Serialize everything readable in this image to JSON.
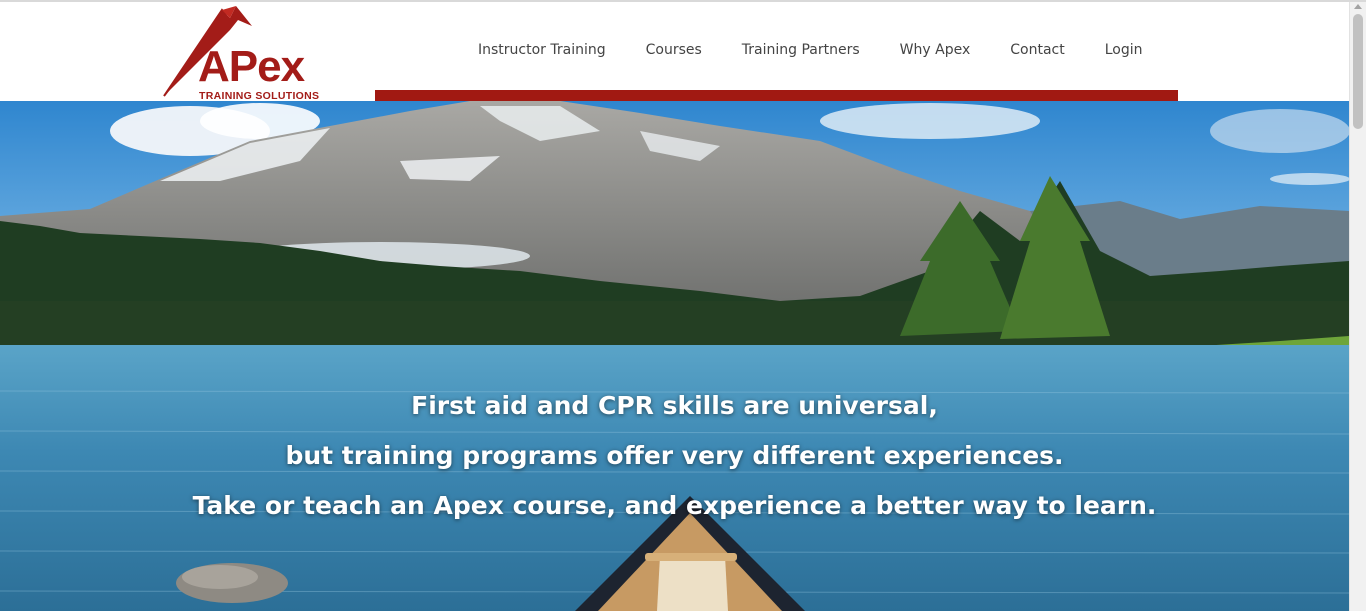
{
  "brand": {
    "name": "APex",
    "tagline": "TRAINING SOLUTIONS",
    "color": "#a31c18"
  },
  "nav": {
    "items": [
      {
        "label": "Instructor Training"
      },
      {
        "label": "Courses"
      },
      {
        "label": "Training Partners"
      },
      {
        "label": "Why Apex"
      },
      {
        "label": "Contact"
      },
      {
        "label": "Login"
      }
    ],
    "accent_color": "#a11912"
  },
  "hero": {
    "lines": [
      "First aid and CPR skills are universal,",
      "but training programs offer very different experiences.",
      "Take or teach an Apex course, and experience a better way to learn."
    ]
  }
}
